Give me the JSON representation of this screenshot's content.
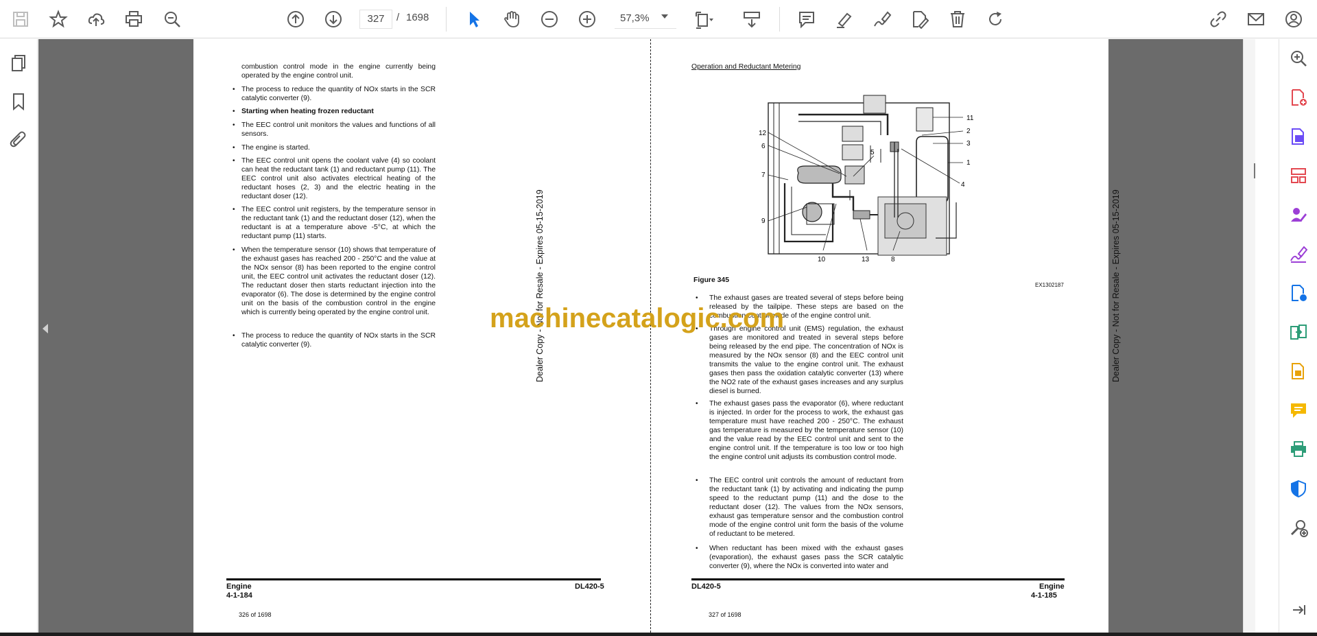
{
  "toolbar": {
    "page_current": "327",
    "page_separator": "/",
    "page_total": "1698",
    "zoom": "57,3%",
    "icons": [
      "save-icon",
      "bookmark-star-icon",
      "upload-icon",
      "print-icon",
      "zoom-search-icon",
      "page-up-icon",
      "page-down-icon",
      "select-arrow-icon",
      "hand-icon",
      "zoom-out-icon",
      "zoom-in-icon",
      "page-fit-icon",
      "scroll-mode-icon",
      "comment-icon",
      "highlight-icon",
      "sign-icon",
      "edit-icon",
      "delete-icon",
      "rotate-icon",
      "link-icon",
      "mail-icon",
      "account-icon"
    ]
  },
  "left_page": {
    "paragraphs": [
      "combustion control mode in the engine currently being operated by the engine control unit.",
      "The process to reduce the quantity of NOx starts in the SCR catalytic converter (9).",
      "Starting when heating frozen reductant",
      "The EEC control unit monitors the values and functions of all sensors.",
      "The engine is started.",
      "The EEC control unit opens the coolant valve (4) so coolant can heat the reductant tank (1) and reductant pump (11). The EEC control unit also activates electrical heating of the reductant hoses (2, 3) and the electric heating in the reductant doser (12).",
      "The EEC control unit registers, by the temperature sensor in the reductant tank (1) and the reductant doser (12), when the reductant is at a temperature above -5°C, at which the reductant pump (11) starts.",
      "When the temperature sensor (10) shows that temperature of the exhaust gases has reached 200 - 250°C and the value at the NOx sensor (8) has been reported to the engine control unit, the EEC control unit activates the reductant doser (12). The reductant doser then starts reductant injection into the evaporator (6). The dose is determined by the engine control unit on the basis of the combustion control in the engine which is currently being operated by the engine control unit.",
      "The process to reduce the quantity of NOx starts in the SCR catalytic converter (9)."
    ],
    "vertical_stamp": "Dealer Copy - Not for Resale - Expires 05-15-2019",
    "footer_left_title": "Engine",
    "footer_left_page": "4-1-184",
    "footer_right": "DL420-5",
    "page_of": "326 of 1698"
  },
  "right_page": {
    "section_title": "Operation and Reductant Metering",
    "figure_caption": "Figure 345",
    "figure_code": "EX1302187",
    "callouts": [
      "11",
      "2",
      "3",
      "1",
      "4",
      "12",
      "6",
      "5",
      "7",
      "9",
      "10",
      "13",
      "8"
    ],
    "paragraphs": [
      "The exhaust gases are treated several of steps before being released by the tailpipe. These steps are based on the combustion control mode of the engine control unit.",
      "Through engine control unit (EMS) regulation, the exhaust gases are monitored and treated in several steps before being released by the end pipe. The concentration of NOx is measured by the NOx sensor (8) and the EEC control unit transmits the value to the engine control unit. The exhaust gases then pass the oxidation catalytic converter (13) where the NO2 rate of the exhaust gases increases and any surplus diesel is burned.",
      "The exhaust gases pass the evaporator (6), where reductant is injected. In order for the process to work, the exhaust gas temperature must have reached 200 - 250°C. The exhaust gas temperature is measured by the temperature sensor (10) and the value read by the EEC control unit and sent to the engine control unit. If the temperature is too low or too high the engine control unit adjusts its combustion control mode.",
      "The EEC control unit controls the amount of reductant from the reductant tank (1) by activating and indicating the pump speed to the reductant pump (11) and the dose to the reductant doser (12). The values from the NOx sensors, exhaust gas temperature sensor and the combustion control mode of the engine control unit form the basis of the volume of reductant to be metered.",
      "When reductant has been mixed with the exhaust gases (evaporation), the exhaust gases pass the SCR catalytic converter (9), where the NOx is converted into water and"
    ],
    "vertical_stamp": "Dealer Copy - Not for Resale - Expires 05-15-2019",
    "footer_left": "DL420-5",
    "footer_right_title": "Engine",
    "footer_right_page": "4-1-185",
    "page_of": "327 of 1698"
  },
  "watermark": "machinecatalogic.com",
  "colors": {
    "accent_blue": "#1473e6",
    "watermark": "#d4a21b",
    "viewport_bg": "#6b6b6b"
  }
}
